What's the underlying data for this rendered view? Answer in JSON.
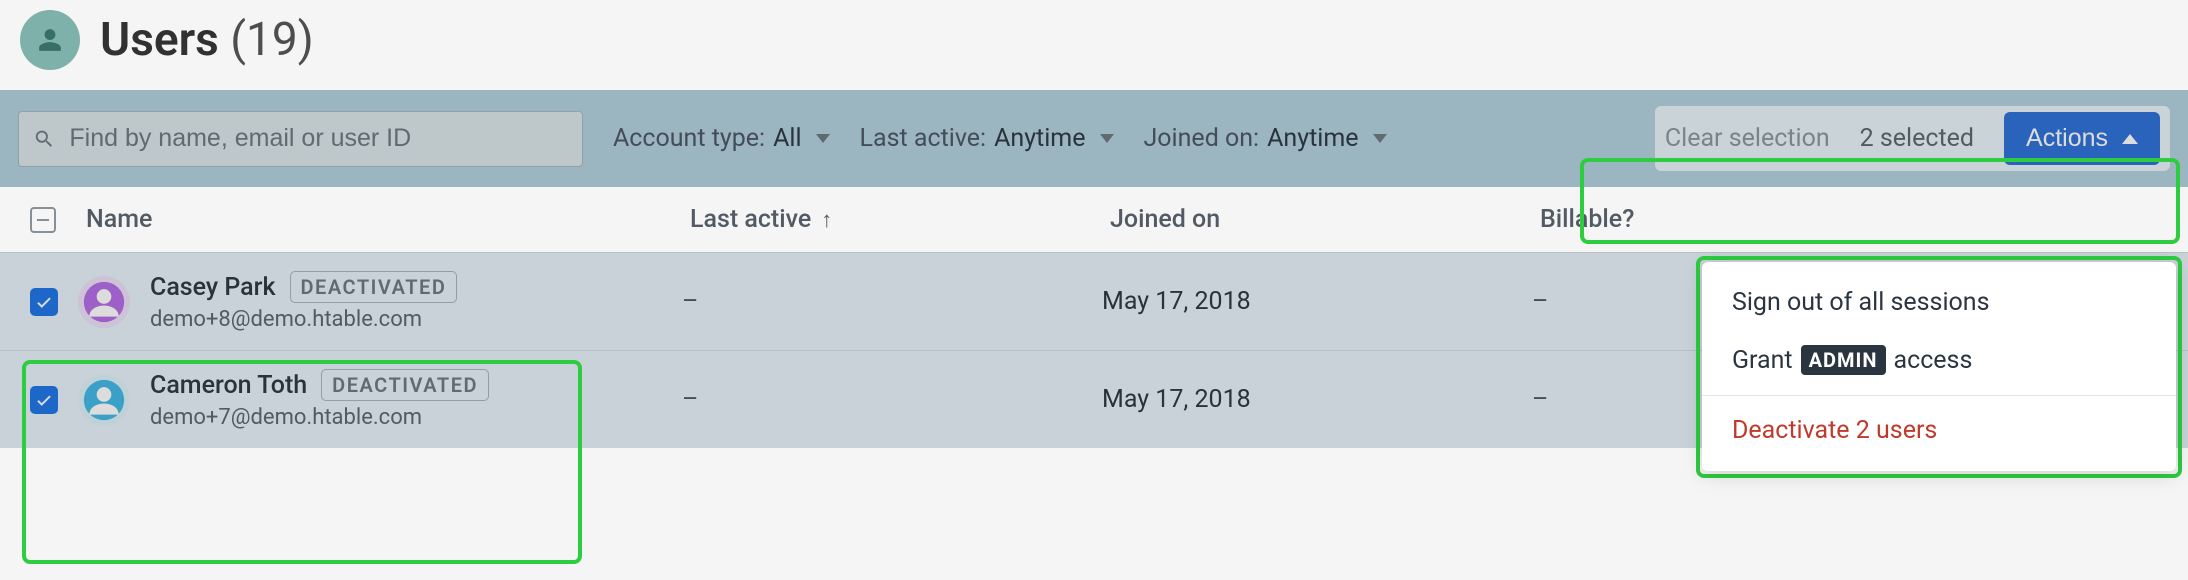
{
  "header": {
    "title": "Users",
    "count": "(19)"
  },
  "toolbar": {
    "search_placeholder": "Find by name, email or user ID",
    "filters": {
      "account_type": {
        "label": "Account type:",
        "value": "All"
      },
      "last_active": {
        "label": "Last active:",
        "value": "Anytime"
      },
      "joined_on": {
        "label": "Joined on:",
        "value": "Anytime"
      }
    },
    "clear_selection": "Clear selection",
    "selected_count": "2 selected",
    "actions_label": "Actions"
  },
  "columns": {
    "name": "Name",
    "last_active": "Last active",
    "joined_on": "Joined on",
    "billable": "Billable?"
  },
  "rows": [
    {
      "name": "Casey Park",
      "badge": "DEACTIVATED",
      "email": "demo+8@demo.htable.com",
      "last_active": "–",
      "joined_on": "May 17, 2018",
      "billable": "–",
      "avatar_color": "#b36be8"
    },
    {
      "name": "Cameron Toth",
      "badge": "DEACTIVATED",
      "email": "demo+7@demo.htable.com",
      "last_active": "–",
      "joined_on": "May 17, 2018",
      "billable": "–",
      "avatar_color": "#3fb8e8"
    }
  ],
  "dropdown": {
    "sign_out": "Sign out of all sessions",
    "grant_prefix": "Grant",
    "grant_badge": "ADMIN",
    "grant_suffix": "access",
    "deactivate": "Deactivate 2 users"
  }
}
